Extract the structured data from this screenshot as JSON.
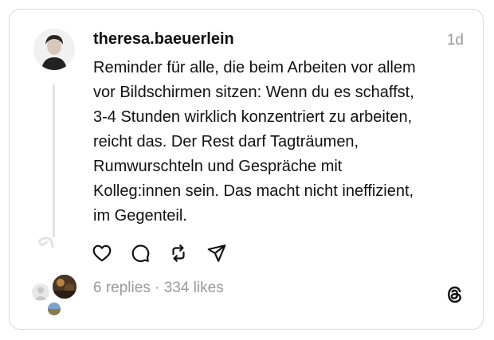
{
  "post": {
    "username": "theresa.baeuerlein",
    "time": "1d",
    "lines": [
      "Reminder für alle, die beim Arbeiten vor allem",
      "vor Bildschirmen sitzen: Wenn du es schaffst,",
      "3-4 Stunden wirklich konzentriert zu arbeiten,",
      "reicht das. Der Rest darf Tagträumen,",
      "Rumwurschteln und Gespräche mit",
      "Kolleg:innen sein. Das macht nicht ineffizient,",
      "im Gegenteil."
    ],
    "stats": "6 replies · 334 likes"
  },
  "icons": {
    "like": "heart-icon",
    "reply": "comment-icon",
    "repost": "repost-icon",
    "share": "send-icon",
    "brand": "threads-logo-icon"
  }
}
